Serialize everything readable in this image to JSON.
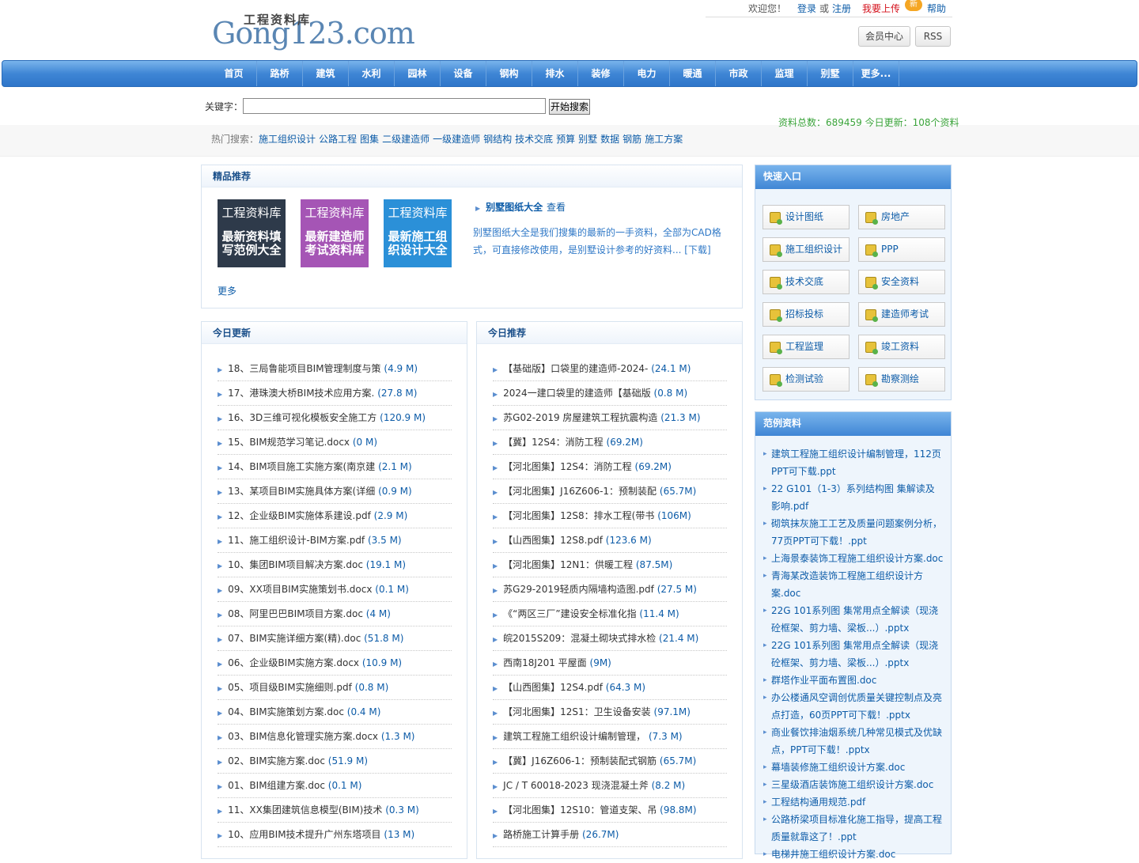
{
  "header": {
    "logo_main": "Gong123.com",
    "logo_cn": "工程资料库",
    "welcome": "欢迎您！",
    "login": "登录",
    "or": "或",
    "register": "注册",
    "upload": "我要上传",
    "new_badge": "新",
    "help": "帮助",
    "member_center": "会员中心",
    "rss": "RSS"
  },
  "nav": [
    "首页",
    "路桥",
    "建筑",
    "水利",
    "园林",
    "设备",
    "钢构",
    "排水",
    "装修",
    "电力",
    "暖通",
    "市政",
    "监理",
    "别墅",
    "更多..."
  ],
  "search": {
    "label": "关键字：",
    "value": "",
    "button": "开始搜索",
    "stats": "资料总数：689459 今日更新：108个资料",
    "hot_label": "热门搜索：",
    "hot": [
      "施工组织设计",
      "公路工程",
      "图集",
      "二级建造师",
      "一级建造师",
      "钢结构",
      "技术交底",
      "预算",
      "别墅",
      "数据",
      "钢筋",
      "施工方案"
    ]
  },
  "featured": {
    "title": "精品推荐",
    "promos": [
      {
        "top": "工程资料库",
        "bottom": "最新资料填写范例大全"
      },
      {
        "top": "工程资料库",
        "bottom": "最新建造师考试资料库"
      },
      {
        "top": "工程资料库",
        "bottom": "最新施工组织设计大全"
      }
    ],
    "item_title": "别墅图纸大全",
    "item_view": "查看",
    "item_desc": "别墅图纸大全是我们搜集的最新的一手资料，全部为CAD格式，可直接修改使用，是别墅设计参考的好资料...  [下载]",
    "more": "更多"
  },
  "today_updates": {
    "title": "今日更新",
    "items": [
      {
        "name": "18、三局鲁能项目BIM管理制度与策",
        "size": "(4.9 M)"
      },
      {
        "name": "17、港珠澳大桥BIM技术应用方案.",
        "size": "(27.8 M)"
      },
      {
        "name": "16、3D三维可视化模板安全施工方",
        "size": "(120.9 M)"
      },
      {
        "name": "15、BIM规范学习笔记.docx",
        "size": "(0 M)"
      },
      {
        "name": "14、BIM项目施工实施方案(南京建",
        "size": "(2.1 M)"
      },
      {
        "name": "13、某项目BIM实施具体方案(详细",
        "size": "(0.9 M)"
      },
      {
        "name": "12、企业级BIM实施体系建设.pdf",
        "size": "(2.9 M)"
      },
      {
        "name": "11、施工组织设计-BIM方案.pdf",
        "size": "(3.5 M)"
      },
      {
        "name": "10、集团BIM项目解决方案.doc",
        "size": "(19.1 M)"
      },
      {
        "name": "09、XX项目BIM实施策划书.docx",
        "size": "(0.1 M)"
      },
      {
        "name": "08、阿里巴巴BIM项目方案.doc",
        "size": "(4 M)"
      },
      {
        "name": "07、BIM实施详细方案(精).doc",
        "size": "(51.8 M)"
      },
      {
        "name": "06、企业级BIM实施方案.docx",
        "size": "(10.9 M)"
      },
      {
        "name": "05、项目级BIM实施细则.pdf",
        "size": "(0.8 M)"
      },
      {
        "name": "04、BIM实施策划方案.doc",
        "size": "(0.4 M)"
      },
      {
        "name": "03、BIM信息化管理实施方案.docx",
        "size": "(1.3 M)"
      },
      {
        "name": "02、BIM实施方案.doc",
        "size": "(51.9 M)"
      },
      {
        "name": "01、BIM组建方案.doc",
        "size": "(0.1 M)"
      },
      {
        "name": "11、XX集团建筑信息模型(BIM)技术",
        "size": "(0.3 M)"
      },
      {
        "name": "10、应用BIM技术提升广州东塔项目",
        "size": "(13 M)"
      }
    ]
  },
  "today_recommend": {
    "title": "今日推荐",
    "items": [
      {
        "name": "【基础版】口袋里的建造师-2024-",
        "size": "(24.1 M)"
      },
      {
        "name": "2024一建口袋里的建造师【基础版",
        "size": "(0.8 M)"
      },
      {
        "name": "苏G02-2019 房屋建筑工程抗震构造",
        "size": "(21.3 M)"
      },
      {
        "name": "【冀】12S4：消防工程",
        "size": "(69.2M)"
      },
      {
        "name": "【河北图集】12S4：消防工程",
        "size": "(69.2M)"
      },
      {
        "name": "【河北图集】J16Z606-1：预制装配",
        "size": "(65.7M)"
      },
      {
        "name": "【河北图集】12S8：排水工程(带书",
        "size": "(106M)"
      },
      {
        "name": "【山西图集】12S8.pdf",
        "size": "(123.6 M)"
      },
      {
        "name": "【河北图集】12N1：供暖工程",
        "size": "(87.5M)"
      },
      {
        "name": "苏G29-2019轻质内隔墙构造图.pdf",
        "size": "(27.5 M)"
      },
      {
        "name": "《“两区三厂”建设安全标准化指",
        "size": "(11.4 M)"
      },
      {
        "name": "皖2015S209：混凝土砌块式排水检",
        "size": "(21.4 M)"
      },
      {
        "name": "西南18J201 平屋面",
        "size": "(9M)"
      },
      {
        "name": "【山西图集】12S4.pdf",
        "size": "(64.3 M)"
      },
      {
        "name": "【河北图集】12S1：卫生设备安装",
        "size": "(97.1M)"
      },
      {
        "name": "建筑工程施工组织设计编制管理，",
        "size": "(7.3 M)"
      },
      {
        "name": "【冀】J16Z606-1：预制装配式钢筋",
        "size": "(65.7M)"
      },
      {
        "name": "JC / T 60018-2023 现浇混凝土斧",
        "size": "(8.2 M)"
      },
      {
        "name": "【河北图集】12S10：管道支架、吊",
        "size": "(98.8M)"
      },
      {
        "name": "路桥施工计算手册",
        "size": "(26.7M)"
      }
    ]
  },
  "quick": {
    "title": "快速入口",
    "items": [
      "设计图纸",
      "房地产",
      "施工组织设计",
      "PPP",
      "技术交底",
      "安全资料",
      "招标投标",
      "建造师考试",
      "工程监理",
      "竣工资料",
      "检测试验",
      "勘察测绘"
    ]
  },
  "examples": {
    "title": "范例资料",
    "items": [
      "建筑工程施工组织设计编制管理，112页PPT可下载.ppt",
      "22 G101（1-3）系列结构图 集解读及影响.pdf",
      "砌筑抹灰施工工艺及质量问题案例分析，77页PPT可下载！.ppt",
      "上海景泰装饰工程施工组织设计方案.doc",
      "青海某改造装饰工程施工组织设计方案.doc",
      "22G 101系列图 集常用点全解读（现浇砼框架、剪力墙、梁板...）.pptx",
      "22G 101系列图 集常用点全解读（现浇砼框架、剪力墙、梁板...）.pptx",
      "群塔作业平面布置图.doc",
      "办公楼通风空调创优质量关键控制点及亮点打造，60页PPT可下载！.pptx",
      "商业餐饮排油烟系统几种常见模式及优缺点，PPT可下载！.pptx",
      "幕墙装修施工组织设计方案.doc",
      "三星级酒店装饰施工组织设计方案.doc",
      "工程结构通用规范.pdf",
      "公路桥梁项目标准化施工指导，提高工程质量就靠这了！.ppt",
      "电梯井施工组织设计方案.doc"
    ]
  },
  "colors": {
    "nav": "#3f86d5",
    "link": "#0d5ca8",
    "stats": "#3aa33a",
    "upload": "#d4101b"
  }
}
